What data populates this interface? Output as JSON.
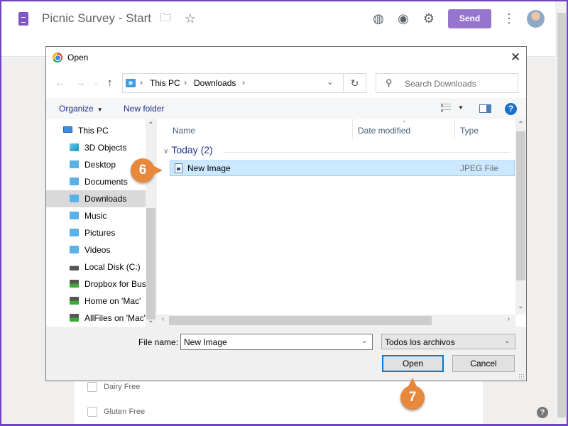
{
  "app": {
    "title": "Picnic Survey - Start",
    "send_label": "Send",
    "icons": [
      "forms-logo-icon",
      "folder-icon",
      "star-icon",
      "palette-icon",
      "eye-icon",
      "gear-icon",
      "more-vert-icon",
      "avatar"
    ],
    "brand_color": "#9575cd"
  },
  "form_behind": {
    "options": [
      "Dairy Free",
      "Gluten Free"
    ]
  },
  "dialog": {
    "title": "Open",
    "close_glyph": "✕",
    "address": {
      "crumbs": [
        "This PC",
        "Downloads"
      ]
    },
    "search_placeholder": "Search Downloads",
    "toolbar": {
      "organize": "Organize",
      "new_folder": "New folder",
      "help": "?"
    },
    "nav": [
      {
        "label": "This PC",
        "icon": "pc",
        "selected": false
      },
      {
        "label": "3D Objects",
        "icon": "folder-3d",
        "selected": false
      },
      {
        "label": "Desktop",
        "icon": "folder",
        "selected": false
      },
      {
        "label": "Documents",
        "icon": "folder",
        "selected": false
      },
      {
        "label": "Downloads",
        "icon": "folder",
        "selected": true
      },
      {
        "label": "Music",
        "icon": "folder",
        "selected": false
      },
      {
        "label": "Pictures",
        "icon": "folder",
        "selected": false
      },
      {
        "label": "Videos",
        "icon": "folder",
        "selected": false
      },
      {
        "label": "Local Disk (C:)",
        "icon": "disk",
        "selected": false
      },
      {
        "label": "Dropbox for Bus",
        "icon": "network-drive",
        "selected": false
      },
      {
        "label": "Home on 'Mac'",
        "icon": "network-drive",
        "selected": false
      },
      {
        "label": "AllFiles on 'Mac'",
        "icon": "network-drive",
        "selected": false
      }
    ],
    "columns": [
      "Name",
      "Date modified",
      "Type"
    ],
    "group": "Today (2)",
    "files": [
      {
        "name": "New Image",
        "date": "",
        "type": "JPEG File",
        "selected": true
      }
    ],
    "file_name_label": "File name:",
    "file_name_value": "New Image",
    "file_type": "Todos los archivos",
    "open_label": "Open",
    "cancel_label": "Cancel"
  },
  "callouts": [
    "6",
    "7"
  ],
  "help_glyph": "?"
}
